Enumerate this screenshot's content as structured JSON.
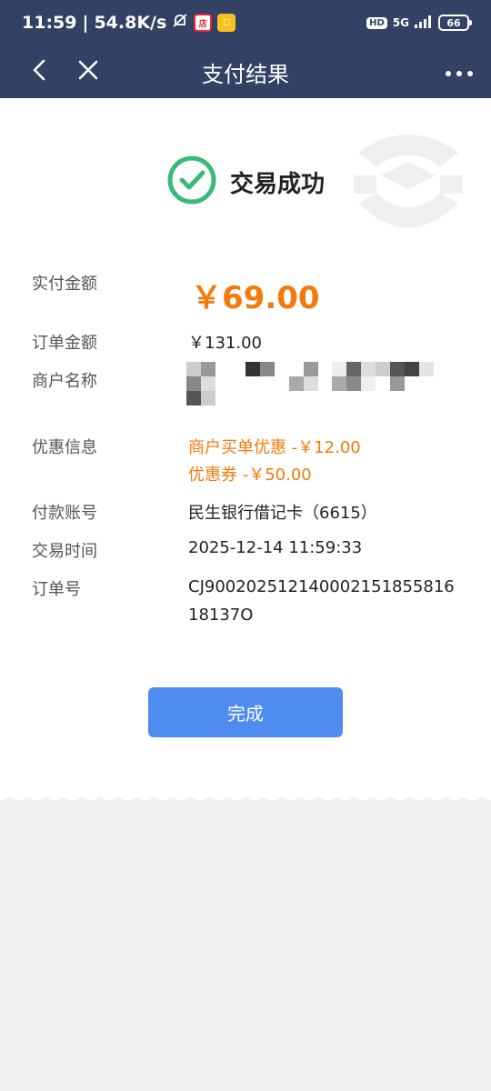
{
  "status_bar": {
    "time": "11:59",
    "speed": "54.8K/s",
    "hd_label": "HD",
    "network": "5G",
    "battery": "66"
  },
  "navbar": {
    "title": "支付结果",
    "back_icon": "chevron-left-icon",
    "close_icon": "close-icon",
    "more_icon": "more-dots-icon"
  },
  "result": {
    "status_text": "交易成功",
    "icon": "check-circle-icon",
    "icon_color": "#3cb878"
  },
  "details": {
    "paid_label": "实付金额",
    "paid_value": "￥69.00",
    "order_amount_label": "订单金额",
    "order_amount_value": "￥131.00",
    "merchant_label": "商户名称",
    "discount_label": "优惠信息",
    "discount_line1": "商户买单优惠 -￥12.00",
    "discount_line2": "优惠券 -￥50.00",
    "account_label": "付款账号",
    "account_value": "民生银行借记卡（6615）",
    "time_label": "交易时间",
    "time_value": "2025-12-14 11:59:33",
    "order_no_label": "订单号",
    "order_no_value": "CJ90020251214000215185581618137O"
  },
  "done_button": "完成",
  "colors": {
    "header_bg": "#324164",
    "accent_orange": "#f47a0c",
    "button_blue": "#4f8cef"
  }
}
